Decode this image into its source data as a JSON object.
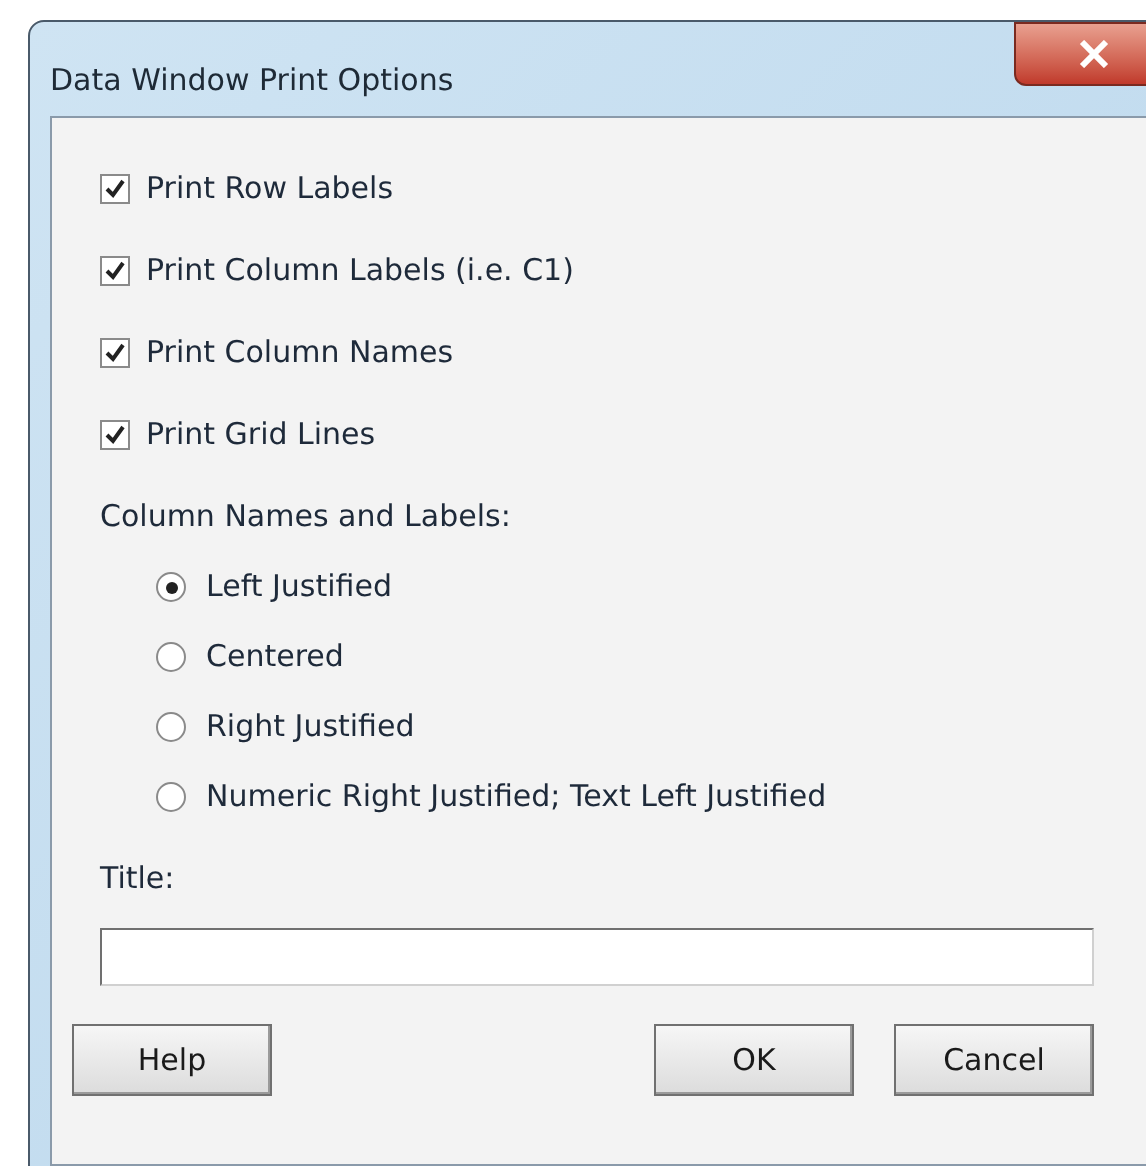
{
  "window": {
    "title": "Data Window Print Options"
  },
  "checkboxes": [
    {
      "label": "Print Row Labels",
      "checked": true
    },
    {
      "label": "Print Column Labels (i.e. C1)",
      "checked": true
    },
    {
      "label": "Print Column Names",
      "checked": true
    },
    {
      "label": "Print Grid Lines",
      "checked": true
    }
  ],
  "justification": {
    "label": "Column Names and Labels:",
    "options": [
      {
        "label": "Left Justified",
        "selected": true
      },
      {
        "label": "Centered",
        "selected": false
      },
      {
        "label": "Right Justified",
        "selected": false
      },
      {
        "label": "Numeric Right Justified; Text Left Justified",
        "selected": false
      }
    ]
  },
  "title_field": {
    "label": "Title:"
  },
  "buttons": [
    {
      "label": "Help",
      "kind": "left"
    },
    {
      "label": "OK",
      "kind": "right"
    },
    {
      "label": "Cancel",
      "kind": "right"
    }
  ]
}
